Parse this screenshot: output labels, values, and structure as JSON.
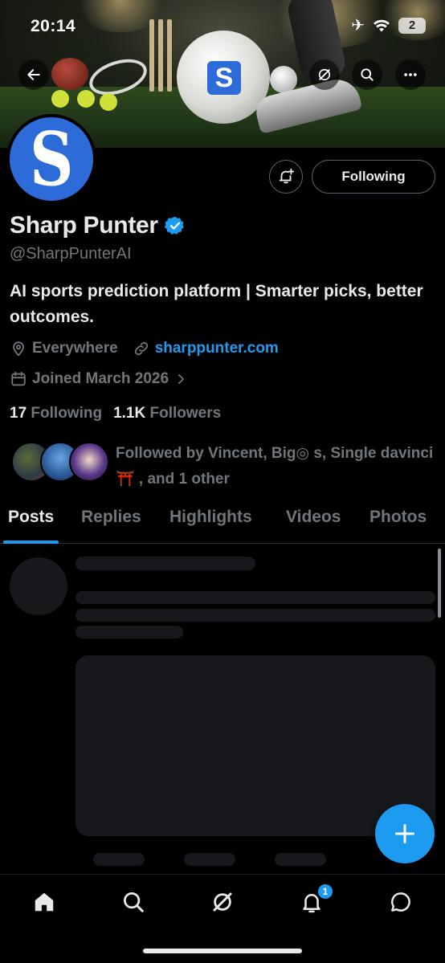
{
  "status_bar": {
    "time": "20:14",
    "battery": "2"
  },
  "profile": {
    "avatar_letter": "S",
    "name": "Sharp Punter",
    "handle": "@SharpPunterAI",
    "bio": "AI sports prediction platform | Smarter picks, better outcomes.",
    "location": "Everywhere",
    "website": "sharppunter.com",
    "joined": "Joined March 2026",
    "following_count": "17",
    "following_label": "Following",
    "followers_count": "1.1K",
    "followers_label": "Followers",
    "followed_by": "Followed by Vincent, Big◎ s, Single davinci ⛩️ , and 1 other",
    "banner_logo_letter": "S"
  },
  "actions": {
    "following_button": "Following"
  },
  "tabs": [
    {
      "label": "Posts",
      "active": true
    },
    {
      "label": "Replies",
      "active": false
    },
    {
      "label": "Highlights",
      "active": false
    },
    {
      "label": "Videos",
      "active": false
    },
    {
      "label": "Photos",
      "active": false
    }
  ],
  "nav": {
    "notifications_badge": "1"
  },
  "icons": [
    "back-arrow-icon",
    "grok-icon",
    "search-icon",
    "more-icon",
    "notification-bell-plus-icon",
    "verified-badge-icon",
    "location-pin-icon",
    "link-icon",
    "calendar-icon",
    "chevron-right-icon",
    "plus-icon",
    "home-icon",
    "explore-icon",
    "grok-nav-icon",
    "notifications-icon",
    "messages-icon"
  ],
  "colors": {
    "accent": "#1d9bf0",
    "background": "#000000",
    "muted_text": "#71767b",
    "avatar_blue": "#2d6bd8"
  }
}
